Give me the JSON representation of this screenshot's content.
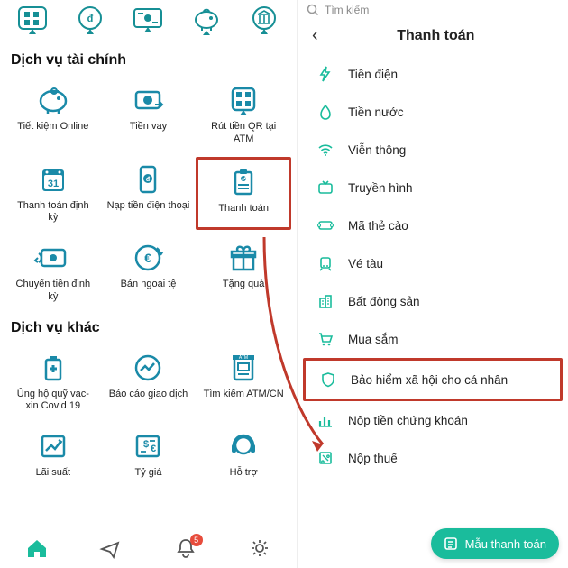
{
  "left": {
    "section1_title": "Dịch vụ tài chính",
    "section2_title": "Dịch vụ khác",
    "tiles": {
      "tietkiem": "Tiết kiệm Online",
      "tienvay": "Tiền vay",
      "rutqr": "Rút tiền QR tại ATM",
      "ttdk": "Thanh toán định kỳ",
      "napdt": "Nạp tiền điện thoại",
      "thanhtoan": "Thanh toán",
      "ctdk": "Chuyển tiền định kỳ",
      "bnt": "Bán ngoại tệ",
      "tangqua": "Tặng quà",
      "ungho": "Ủng hộ quỹ vac-xin Covid 19",
      "baocao": "Báo cáo giao dịch",
      "timatm": "Tìm kiếm ATM/CN",
      "laisuat": "Lãi suất",
      "tygia": "Tỷ giá",
      "hotro": "Hỗ trợ"
    },
    "badge_count": "5"
  },
  "right": {
    "search_placeholder": "Tìm kiếm",
    "title": "Thanh toán",
    "items": {
      "tiendien": "Tiền điện",
      "tiennuoc": "Tiền nước",
      "vienthong": "Viễn thông",
      "truyenhinh": "Truyền hình",
      "mathecao": "Mã thẻ cào",
      "vetau": "Vé tàu",
      "batdongsan": "Bất động sản",
      "muasam": "Mua sắm",
      "bhxh": "Bảo hiểm xã hội cho cá nhân",
      "nopck": "Nộp tiền chứng khoán",
      "nopthue": "Nộp thuế"
    },
    "fab_label": "Mẫu thanh toán"
  }
}
